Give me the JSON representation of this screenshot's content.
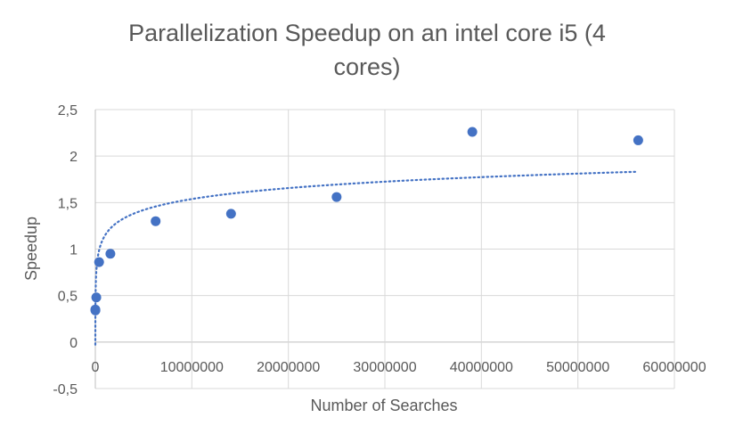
{
  "chart_data": {
    "type": "scatter",
    "title_lines": [
      "Parallelization Speedup on an intel core i5 (4",
      "cores)"
    ],
    "xlabel": "Number of Searches",
    "ylabel": "Speedup",
    "xlim": [
      0,
      60000000
    ],
    "ylim": [
      -0.5,
      2.5
    ],
    "x_ticks": [
      0,
      10000000,
      20000000,
      30000000,
      40000000,
      50000000,
      60000000
    ],
    "x_tick_labels": [
      "0",
      "10000000",
      "20000000",
      "30000000",
      "40000000",
      "50000000",
      "60000000"
    ],
    "y_ticks": [
      -0.5,
      0,
      0.5,
      1,
      1.5,
      2,
      2.5
    ],
    "y_tick_labels": [
      "-0,5",
      "0",
      "0,5",
      "1",
      "1,5",
      "2",
      "2,5"
    ],
    "grid": "vertical and horizontal major gridlines",
    "legend": "none",
    "marker_color": "#4472c4",
    "trendline": {
      "type": "logarithmic",
      "style": "dotted",
      "color": "#4472c4"
    },
    "series": [
      {
        "points": [
          {
            "x": 1000,
            "y": 0.35
          },
          {
            "x": 10000,
            "y": 0.34
          },
          {
            "x": 100000,
            "y": 0.48
          },
          {
            "x": 390000,
            "y": 0.86
          },
          {
            "x": 1560000,
            "y": 0.95
          },
          {
            "x": 6250000,
            "y": 1.3
          },
          {
            "x": 14060000,
            "y": 1.38
          },
          {
            "x": 25000000,
            "y": 1.56
          },
          {
            "x": 39060000,
            "y": 2.26
          },
          {
            "x": 56250000,
            "y": 2.17
          }
        ]
      }
    ]
  }
}
